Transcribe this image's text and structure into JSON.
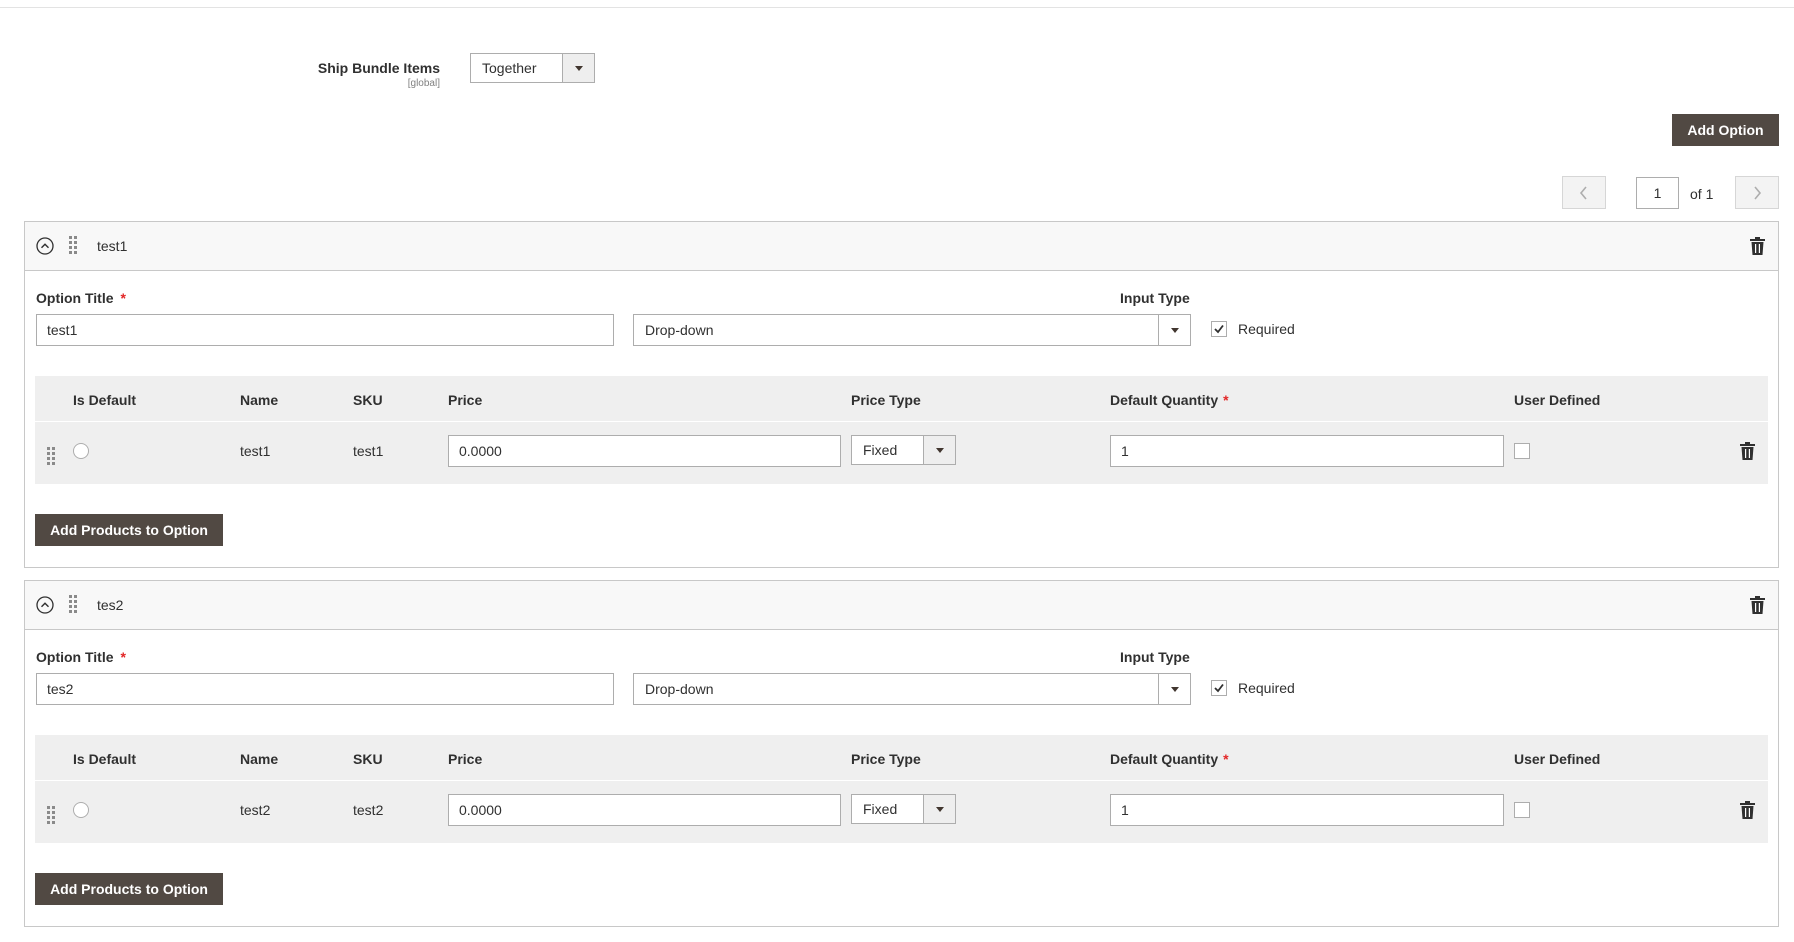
{
  "ship_bundle": {
    "label": "Ship Bundle Items",
    "scope": "[global]",
    "value": "Together"
  },
  "add_option_label": "Add Option",
  "pager": {
    "current_page": "1",
    "of_text": "of 1"
  },
  "options": [
    {
      "name": "test1",
      "title_label": "Option Title",
      "title_required_mark": "*",
      "title_value": "test1",
      "input_type_label": "Input Type",
      "input_type_value": "Drop-down",
      "required_label": "Required",
      "required_checked": true,
      "columns": {
        "is_default": "Is Default",
        "name": "Name",
        "sku": "SKU",
        "price": "Price",
        "price_type": "Price Type",
        "default_quantity": "Default Quantity",
        "default_quantity_required_mark": "*",
        "user_defined": "User Defined"
      },
      "rows": [
        {
          "name": "test1",
          "sku": "test1",
          "price": "0.0000",
          "price_type": "Fixed",
          "default_quantity": "1"
        }
      ],
      "add_products_label": "Add Products to Option"
    },
    {
      "name": "tes2",
      "title_label": "Option Title",
      "title_required_mark": "*",
      "title_value": "tes2",
      "input_type_label": "Input Type",
      "input_type_value": "Drop-down",
      "required_label": "Required",
      "required_checked": true,
      "columns": {
        "is_default": "Is Default",
        "name": "Name",
        "sku": "SKU",
        "price": "Price",
        "price_type": "Price Type",
        "default_quantity": "Default Quantity",
        "default_quantity_required_mark": "*",
        "user_defined": "User Defined"
      },
      "rows": [
        {
          "name": "test2",
          "sku": "test2",
          "price": "0.0000",
          "price_type": "Fixed",
          "default_quantity": "1"
        }
      ],
      "add_products_label": "Add Products to Option"
    }
  ],
  "colors": {
    "dark_button": "#514943",
    "required_star": "#e22626",
    "border": "#adadad",
    "grid_background": "#efefef"
  }
}
